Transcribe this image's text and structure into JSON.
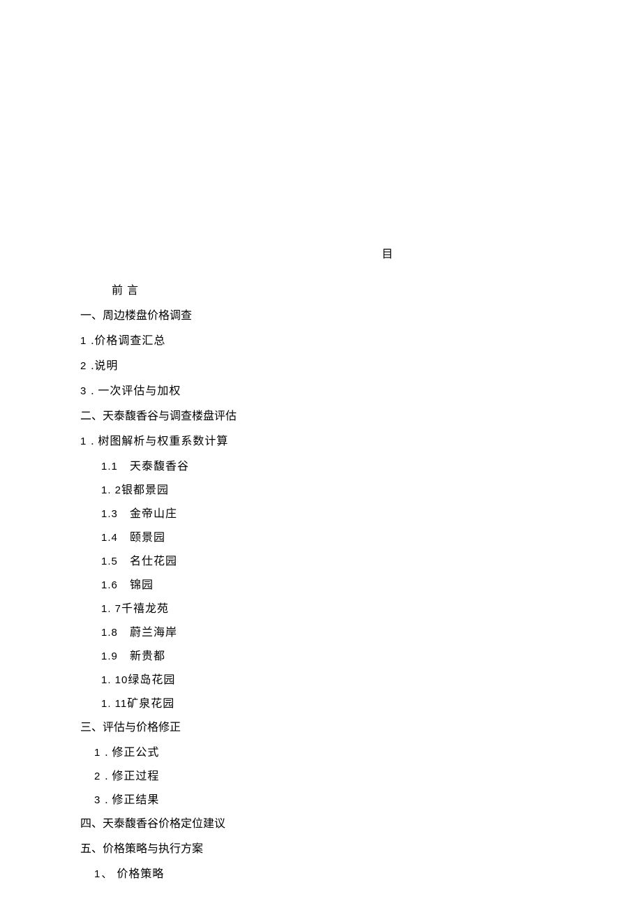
{
  "header_char": "目",
  "preface": "前  言",
  "items": [
    {
      "type": "h1",
      "text": "一、周边楼盘价格调查"
    },
    {
      "type": "numdot",
      "num": "1",
      "text": ".价格调查汇总"
    },
    {
      "type": "numdot",
      "num": "2",
      "text": ".说明"
    },
    {
      "type": "numdot",
      "num": "3",
      "text": ". 一次评估与加权"
    },
    {
      "type": "h1",
      "text": "二、天泰馥香谷与调查楼盘评估"
    },
    {
      "type": "numdot",
      "num": "1",
      "text": ". 树图解析与权重系数计算"
    },
    {
      "type": "sub",
      "num": "1.1",
      "text": "天泰馥香谷",
      "spaced": true
    },
    {
      "type": "sub",
      "num": "1.  2",
      "text": "银都景园",
      "spaced": false
    },
    {
      "type": "sub",
      "num": "1.3",
      "text": "金帝山庄",
      "spaced": true
    },
    {
      "type": "sub",
      "num": "1.4",
      "text": "颐景园",
      "spaced": true
    },
    {
      "type": "sub",
      "num": "1.5",
      "text": "名仕花园",
      "spaced": true
    },
    {
      "type": "sub",
      "num": "1.6",
      "text": "锦园",
      "spaced": true
    },
    {
      "type": "sub",
      "num": "1.  7",
      "text": "千禧龙苑",
      "spaced": false
    },
    {
      "type": "sub",
      "num": "1.8",
      "text": "蔚兰海岸",
      "spaced": true
    },
    {
      "type": "sub",
      "num": "1.9",
      "text": "新贵都",
      "spaced": true
    },
    {
      "type": "sub",
      "num": "1. 10",
      "text": "绿岛花园",
      "spaced": false
    },
    {
      "type": "sub",
      "num": "1. 11",
      "text": "矿泉花园",
      "spaced": false
    },
    {
      "type": "h1",
      "text": "三、评估与价格修正"
    },
    {
      "type": "sub2",
      "num": "1",
      "text": ". 修正公式"
    },
    {
      "type": "sub2",
      "num": "2",
      "text": ". 修正过程"
    },
    {
      "type": "sub2",
      "num": "3",
      "text": ". 修正结果"
    },
    {
      "type": "h1",
      "text": "四、天泰馥香谷价格定位建议"
    },
    {
      "type": "h1",
      "text": "五、价格策略与执行方案"
    },
    {
      "type": "sub2cn",
      "num": "1、",
      "text": "价格策略"
    }
  ]
}
